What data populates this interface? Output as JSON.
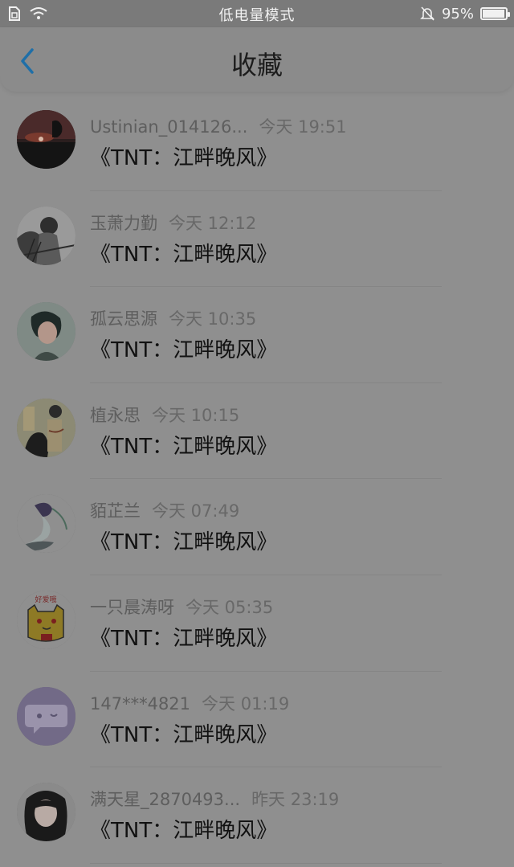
{
  "status": {
    "mode_text": "低电量模式",
    "battery_text": "95%",
    "battery_level": 0.95
  },
  "header": {
    "title": "收藏"
  },
  "items": [
    {
      "user": "Ustinian_014126...",
      "time": "今天 19:51",
      "title": "《TNT：江畔晚风》"
    },
    {
      "user": "玉萧力勤",
      "time": "今天 12:12",
      "title": "《TNT：江畔晚风》"
    },
    {
      "user": "孤云思源",
      "time": "今天 10:35",
      "title": "《TNT：江畔晚风》"
    },
    {
      "user": "植永思",
      "time": "今天 10:15",
      "title": "《TNT：江畔晚风》"
    },
    {
      "user": "貊芷兰",
      "time": "今天 07:49",
      "title": "《TNT：江畔晚风》"
    },
    {
      "user": "一只晨涛呀",
      "time": "今天 05:35",
      "title": "《TNT：江畔晚风》",
      "avatar_badge": "好爱哦"
    },
    {
      "user": "147***4821",
      "time": "今天 01:19",
      "title": "《TNT：江畔晚风》"
    },
    {
      "user": "满天星_2870493...",
      "time": "昨天 23:19",
      "title": "《TNT：江畔晚风》"
    }
  ]
}
